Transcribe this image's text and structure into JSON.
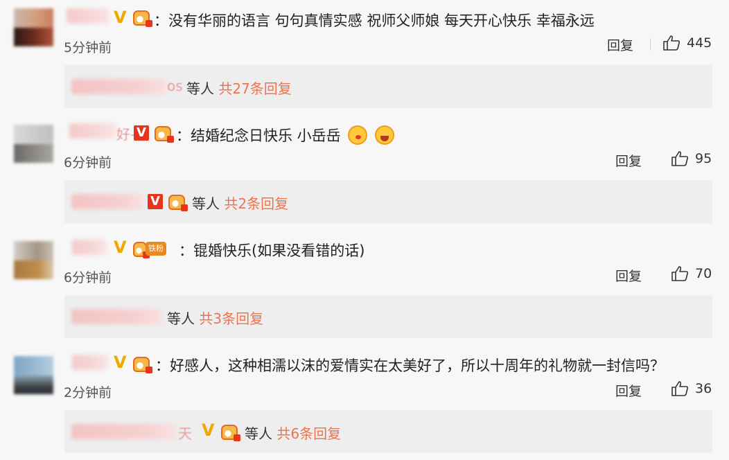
{
  "comments": [
    {
      "text": "：没有华丽的语言 句句真情实感 祝师父师娘 每天开心快乐 幸福永远",
      "time": "5分钟前",
      "reply": "回复",
      "likes": "445",
      "sub": {
        "suffix": "os",
        "dengren": "等人",
        "count": "共27条回复"
      }
    },
    {
      "name_suffix": "好-",
      "text": "：结婚纪念日快乐 小岳岳",
      "time": "6分钟前",
      "reply": "回复",
      "likes": "95",
      "sub": {
        "dengren": "等人",
        "count": "共2条回复"
      }
    },
    {
      "tag": "铁粉",
      "text": "：锟婚快乐(如果没看错的话)",
      "time": "6分钟前",
      "reply": "回复",
      "likes": "70",
      "sub": {
        "dengren": "等人",
        "count": "共3条回复"
      }
    },
    {
      "text": "：好感人，这种相濡以沫的爱情实在太美好了，所以十周年的礼物就一封信吗？",
      "time": "2分钟前",
      "reply": "回复",
      "likes": "36",
      "sub": {
        "suffix": "天",
        "dengren": "等人",
        "count": "共6条回复"
      }
    }
  ],
  "colors": {
    "accent": "#eb7350",
    "vip_gold": "#f0a800",
    "vip_red": "#e8341c"
  },
  "icons": [
    "avatar",
    "vip-badge-icon",
    "crown-badge-icon",
    "thumbs-up-icon",
    "kiss-emoji-icon",
    "cry-emoji-icon"
  ]
}
